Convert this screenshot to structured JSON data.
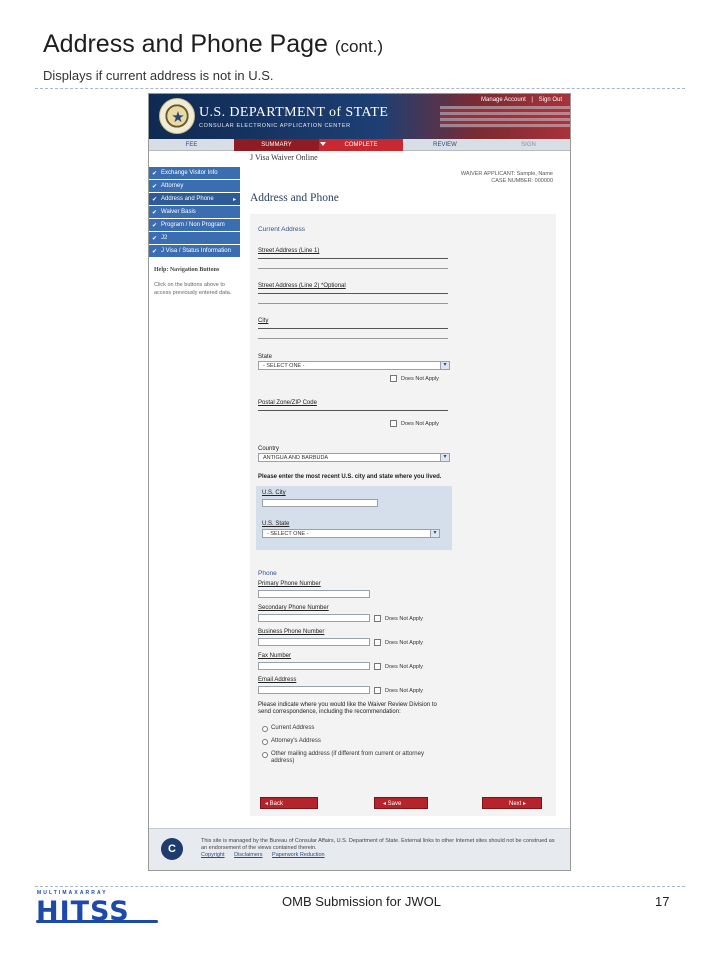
{
  "slide": {
    "title": "Address and Phone Page",
    "title_suffix": "(cont.)",
    "subtitle": "Displays if current address is not in U.S.",
    "footer_center": "OMB Submission for JWOL",
    "page_number": "17",
    "logo_top": "MULTIMAXARRAY",
    "logo_text": "HITSS"
  },
  "app": {
    "top_links": [
      "Manage Account",
      "Sign Out"
    ],
    "dept_name": "U.S. DEPARTMENT of STATE",
    "dept_sub": "CONSULAR ELECTRONIC APPLICATION CENTER",
    "nav_tabs": [
      "FEE",
      "SUMMARY",
      "COMPLETE",
      "REVIEW",
      "SIGN"
    ],
    "app_title": "J Visa Waiver Online",
    "meta_line1": "WAIVER APPLICANT: Sample, Name",
    "meta_line2": "CASE NUMBER: 000000",
    "page_heading": "Address and Phone"
  },
  "sidebar": {
    "items": [
      {
        "label": "Exchange Visitor Info"
      },
      {
        "label": "Attorney"
      },
      {
        "label": "Address and Phone"
      },
      {
        "label": "Waiver Basis"
      },
      {
        "label": "Program / Non Program"
      },
      {
        "label": "J2"
      },
      {
        "label": "J Visa / Status Information"
      }
    ],
    "help_title": "Help: Navigation Buttons",
    "help_text": "Click on the buttons above to access previously entered data."
  },
  "form": {
    "current_address_title": "Current Address",
    "street1_label": "Street Address (Line 1)",
    "street2_label": "Street Address (Line 2) *Optional",
    "city_label": "City",
    "state_label": "State",
    "state_value": "- SELECT ONE -",
    "does_not_apply": "Does Not Apply",
    "postal_label": "Postal Zone/ZIP Code",
    "country_label": "Country",
    "country_value": "ANTIGUA AND BARBUDA",
    "us_note": "Please enter the most recent U.S. city and state where you lived.",
    "us_city_label": "U.S. City",
    "us_state_label": "U.S. State",
    "us_state_value": "- SELECT ONE -",
    "phone_title": "Phone",
    "primary_phone_label": "Primary Phone Number",
    "secondary_phone_label": "Secondary Phone Number",
    "business_phone_label": "Business Phone Number",
    "fax_label": "Fax Number",
    "email_label": "Email Address",
    "corr_note": "Please indicate where you would like the Waiver Review Division to send correspondence, including the recommendation:",
    "radio_current": "Current Address",
    "radio_attorney": "Attorney's Address",
    "radio_other": "Other mailing address (if different from current or attorney address)"
  },
  "buttons": {
    "back": "◂ Back",
    "save": "◂ Save",
    "next": "Next ▸"
  },
  "app_footer": {
    "text": "This site is managed by the Bureau of Consular Affairs, U.S. Department of State. External links to other Internet sites should not be construed as an endorsement of the views contained therein.",
    "links": [
      "Copyright",
      "Disclaimers",
      "Paperwork Reduction"
    ],
    "seal_letter": "C"
  }
}
